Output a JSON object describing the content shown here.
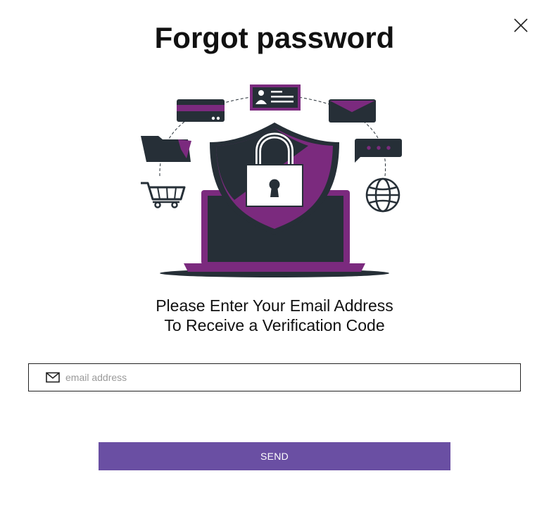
{
  "dialog": {
    "title": "Forgot password",
    "instruction_line1": "Please Enter Your Email Address",
    "instruction_line2": "To Receive a Verification Code",
    "email_field": {
      "value": "",
      "placeholder": "email address",
      "icon": "mail-icon"
    },
    "send_label": "SEND",
    "close_icon": "close-icon"
  },
  "colors": {
    "accent": "#6a4fa3",
    "illustration_purple": "#7b2a7e",
    "illustration_dark": "#262f37"
  },
  "illustration": {
    "icons": [
      "credit-card-icon",
      "id-card-icon",
      "envelope-icon",
      "folder-icon",
      "chat-bubble-icon",
      "shopping-cart-icon",
      "globe-icon",
      "shield-icon",
      "padlock-icon",
      "laptop-icon"
    ]
  }
}
